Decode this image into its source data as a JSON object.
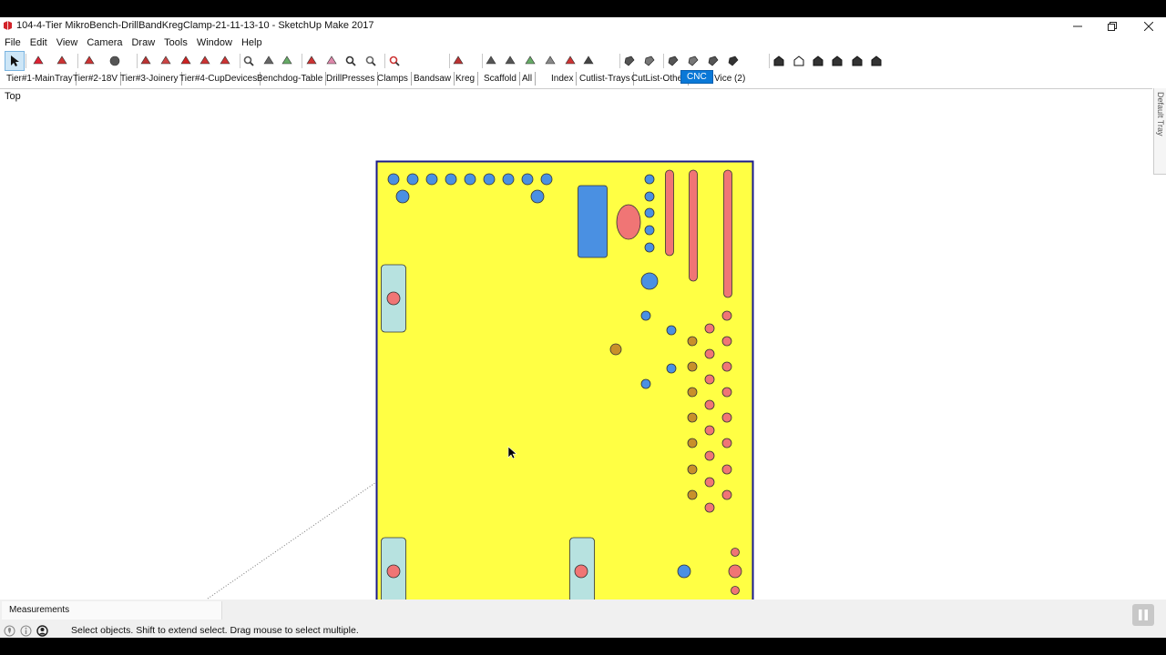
{
  "window": {
    "title": "104-4-Tier MikroBench-DrillBandKregClamp-21-11-13-10 - SketchUp Make 2017"
  },
  "menu": [
    "File",
    "Edit",
    "View",
    "Camera",
    "Draw",
    "Tools",
    "Window",
    "Help"
  ],
  "toolbar": {
    "tools": [
      "select-icon",
      "eraser-icon",
      "pencil-icon",
      "arc-icon",
      "circle-icon",
      "push-pull-icon",
      "follow-me-icon",
      "move-icon",
      "rotate-icon",
      "scale-icon",
      "tape-measure-icon",
      "text-icon",
      "paint-bucket-icon",
      "orbit-icon",
      "pan-icon",
      "zoom-icon",
      "zoom-window-icon",
      "zoom-extents-icon",
      "components-icon",
      "materials-icon",
      "styles-icon",
      "3d-warehouse-icon",
      "dimension-icon",
      "protractor-icon",
      "axes-icon",
      "section-plane-icon",
      "walk-icon",
      "look-around-icon",
      "xray-icon",
      "wireframe-icon",
      "hidden-line-icon",
      "shaded-icon",
      "shaded-textures-icon",
      "monochrome-icon",
      "iso-view-icon",
      "top-view-icon",
      "front-view-icon",
      "right-view-icon",
      "back-view-icon",
      "left-view-icon"
    ],
    "active_tool": "select-icon"
  },
  "scenes": {
    "items": [
      "Tier#1-MainTray",
      "Tier#2-18V",
      "Tier#3-Joinery",
      "Tier#4-CupDevices",
      "Benchdog-Table",
      "DrillPresses",
      "Clamps",
      "Bandsaw",
      "Kreg",
      "Scaffold",
      "All",
      "Index",
      "Cutlist-Trays",
      "CutList-Other",
      "CNC",
      "Vice (2)"
    ],
    "active": "CNC"
  },
  "viewport": {
    "view_name": "Top",
    "colors": {
      "board": "#ffff44",
      "board_edge": "#1a1a8c",
      "blue_hole": "#4a90e2",
      "pink_hole": "#f07575",
      "brown_hole": "#c8902a",
      "slot_fill": "#b7e2e0"
    }
  },
  "tray": {
    "label": "Default Tray"
  },
  "status": {
    "measurements_label": "Measurements",
    "hint": "Select objects. Shift to extend select. Drag mouse to select multiple."
  }
}
